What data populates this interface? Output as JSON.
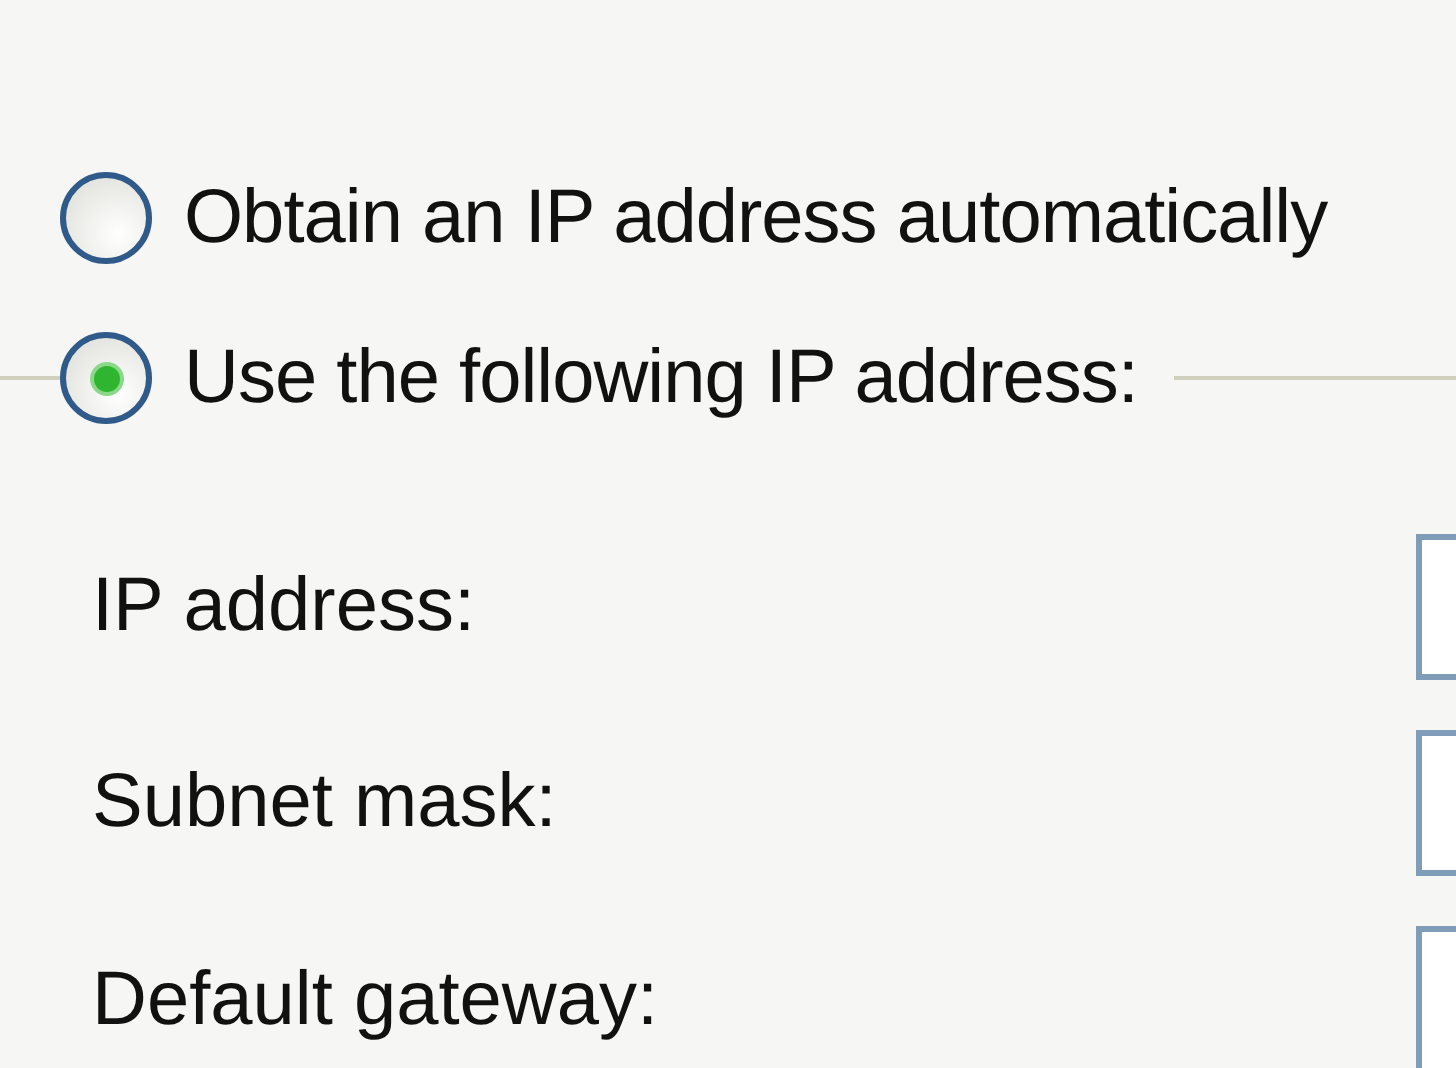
{
  "ip_options": [
    {
      "label": "Obtain an IP address automatically",
      "selected": false
    },
    {
      "label": "Use the following IP address:",
      "selected": true
    }
  ],
  "fields": [
    {
      "label": "IP address:"
    },
    {
      "label": "Subnet mask:"
    },
    {
      "label": "Default gateway:"
    }
  ]
}
